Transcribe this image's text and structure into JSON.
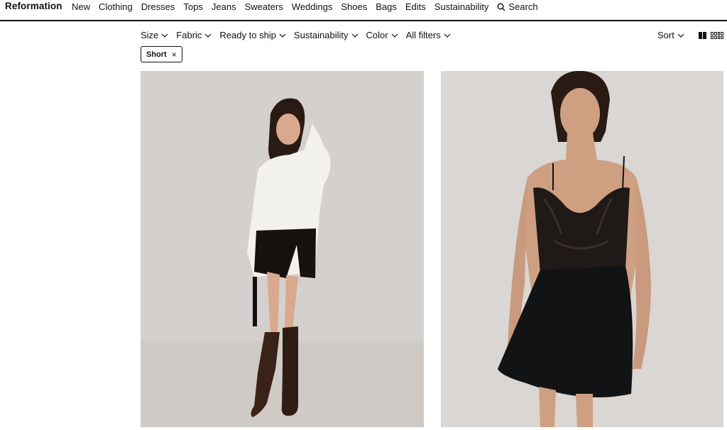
{
  "brand": "Reformation",
  "nav": [
    "New",
    "Clothing",
    "Dresses",
    "Tops",
    "Jeans",
    "Sweaters",
    "Weddings",
    "Shoes",
    "Bags",
    "Edits",
    "Sustainability"
  ],
  "search_label": "Search",
  "filters": [
    "Size",
    "Fabric",
    "Ready to ship",
    "Sustainability",
    "Color",
    "All filters"
  ],
  "sort_label": "Sort",
  "active_chip": "Short",
  "chip_close": "×",
  "products": [
    {
      "image_icon": "product-photo-white-sweater-black-skirt-boots"
    },
    {
      "image_icon": "product-photo-black-lace-slip-dress"
    }
  ],
  "colors": {
    "text": "#111111",
    "background": "#ffffff",
    "card1_bg": "#d4d0cd",
    "card2_bg": "#d9d6d3"
  }
}
